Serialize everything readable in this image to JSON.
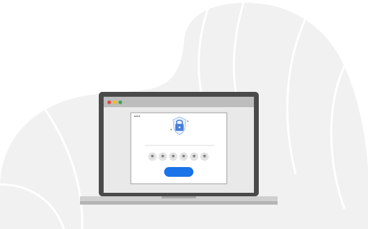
{
  "illustration": {
    "theme": "secure-login",
    "colors": {
      "blob": "#f1f1f1",
      "blob_lines": "#ffffff",
      "laptop_bezel": "#4a4a4a",
      "laptop_base": "#cfcfcf",
      "screen_bg": "#e9e9e9",
      "browser_bar": "#bdbdbd",
      "dot_red": "#e94235",
      "dot_yellow": "#fbbc04",
      "dot_green": "#34a853",
      "card_bg": "#ffffff",
      "card_border": "#9e9e9e",
      "lock": "#8ab4f8",
      "lock_dark": "#4a7fd6",
      "password_circle": "#e3e3e3",
      "password_mark": "#333333",
      "button": "#1a73e8"
    },
    "browser_dots": [
      "dot_red",
      "dot_yellow",
      "dot_green"
    ],
    "icons": [
      "shield-icon",
      "lock-icon",
      "more-dots-icon"
    ],
    "password_masks": [
      "*",
      "*",
      "*",
      "*",
      "*",
      "*"
    ]
  }
}
